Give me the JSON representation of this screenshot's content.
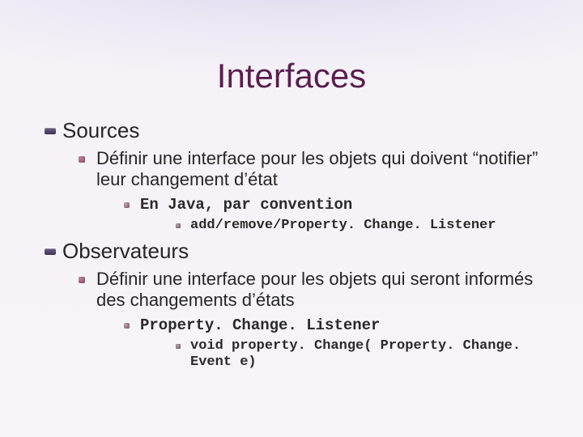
{
  "title": "Interfaces",
  "sections": [
    {
      "heading": "Sources",
      "points": [
        {
          "text": "Définir une interface pour les objets qui doivent “notifier” leur changement d’état",
          "sub": [
            {
              "text": "En Java, par convention",
              "sub": [
                {
                  "text": "add/remove/Property. Change. Listener"
                }
              ]
            }
          ]
        }
      ]
    },
    {
      "heading": "Observateurs",
      "points": [
        {
          "text": "Définir une interface pour les objets qui seront informés des changements d’états",
          "sub": [
            {
              "text": "Property. Change. Listener",
              "sub": [
                {
                  "text": "void property. Change( Property. Change. Event e)"
                }
              ]
            }
          ]
        }
      ]
    }
  ]
}
